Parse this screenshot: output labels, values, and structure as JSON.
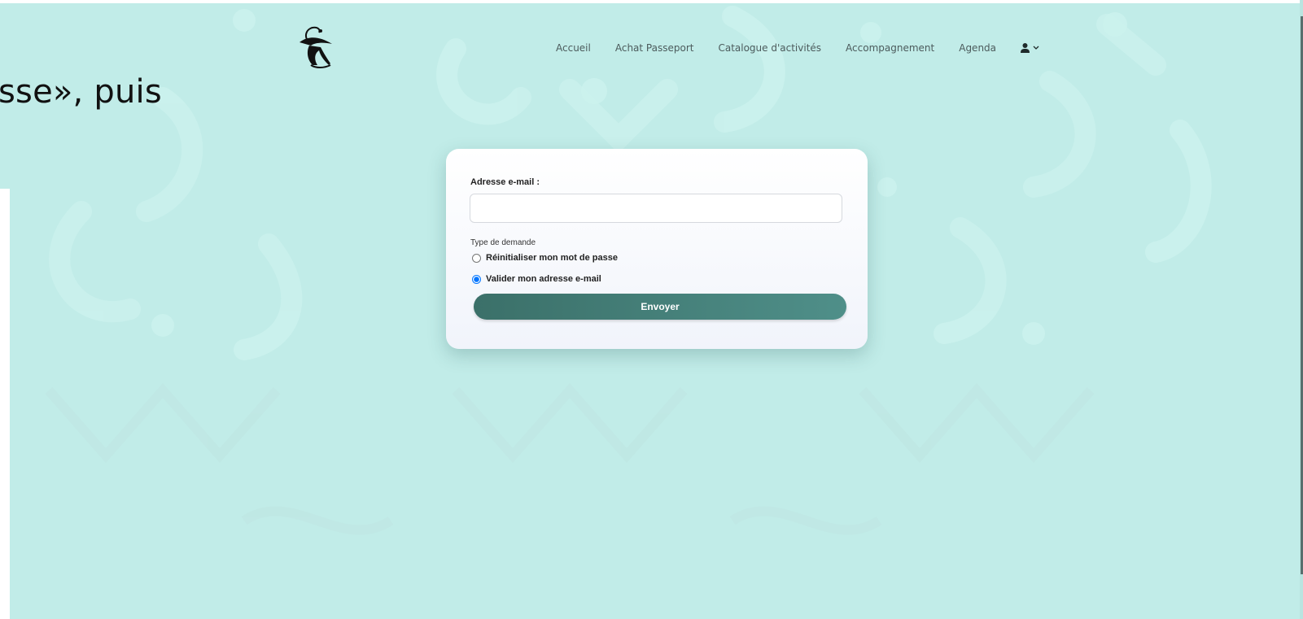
{
  "overlay": {
    "text": "sse», puis"
  },
  "header": {
    "logo_icon": "cat-logo-icon",
    "nav": [
      {
        "label": "Accueil"
      },
      {
        "label": "Achat Passeport"
      },
      {
        "label": "Catalogue d'activités"
      },
      {
        "label": "Accompagnement"
      },
      {
        "label": "Agenda"
      }
    ],
    "user_icon": "user-icon",
    "chevron_icon": "chevron-down-icon"
  },
  "form": {
    "email_label": "Adresse e-mail :",
    "email_value": "",
    "email_placeholder": "",
    "type_label": "Type de demande",
    "options": [
      {
        "label": "Réinitialiser mon mot de passe",
        "checked": false
      },
      {
        "label": "Valider mon adresse e-mail",
        "checked": true
      }
    ],
    "submit_label": "Envoyer"
  },
  "colors": {
    "background": "#c1ece8",
    "button": "#3b7069",
    "nav_text": "#4c5b5c"
  }
}
